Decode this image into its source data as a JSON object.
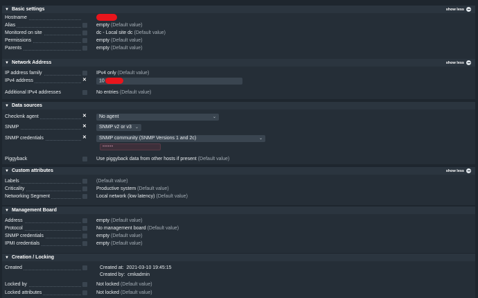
{
  "toggle_label": "show less",
  "sections": {
    "basic": {
      "title": "Basic settings",
      "rows": {
        "hostname": "Hostname",
        "alias": "Alias",
        "alias_value": "empty",
        "monitored": "Monitored on site",
        "monitored_value": "dc - Local site dc",
        "permissions": "Permissions",
        "permissions_value": "empty",
        "parents": "Parents",
        "parents_value": "empty"
      }
    },
    "network": {
      "title": "Network Address",
      "rows": {
        "family": "IP address family",
        "family_value": "IPv4 only",
        "ipv4": "IPv4 address",
        "ipv4_value": "10",
        "additional": "Additional IPv4 addresses",
        "additional_value": "No entries"
      }
    },
    "datasources": {
      "title": "Data sources",
      "rows": {
        "agent": "Checkmk agent",
        "agent_value": "No agent",
        "snmp": "SNMP",
        "snmp_value": "SNMP v2 or v3",
        "snmp_cred": "SNMP credentials",
        "snmp_cred_value": "SNMP community (SNMP Versions 1 and 2c)",
        "password_mask": "••••••",
        "piggyback": "Piggyback",
        "piggyback_value": "Use piggyback data from other hosts if present"
      }
    },
    "custom": {
      "title": "Custom attributes",
      "rows": {
        "labels": "Labels",
        "criticality": "Criticality",
        "criticality_value": "Productive system",
        "netseg": "Networking Segment",
        "netseg_value": "Local network (low latency)"
      }
    },
    "management": {
      "title": "Management Board",
      "rows": {
        "address": "Address",
        "address_value": "empty",
        "protocol": "Protocol",
        "protocol_value": "No management board",
        "snmp_cred": "SNMP credentials",
        "snmp_cred_value": "empty",
        "ipmi": "IPMI credentials",
        "ipmi_value": "empty"
      }
    },
    "creation": {
      "title": "Creation / Locking",
      "rows": {
        "created": "Created",
        "created_at_label": "Created at:",
        "created_at_value": "2021-03-10 19:45:15",
        "created_by_label": "Created by:",
        "created_by_value": "cmkadmin",
        "locked_by": "Locked by",
        "locked_by_value": "Not locked",
        "locked_attrs": "Locked attributes",
        "locked_attrs_value": "Not locked"
      }
    }
  },
  "default_value_text": "(Default value)",
  "colors": {
    "redaction": "#e8151c",
    "background": "#1e262e",
    "header": "#2b353f",
    "body": "#252e37"
  }
}
